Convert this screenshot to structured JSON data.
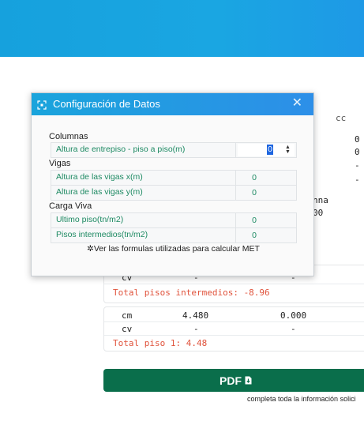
{
  "background": {
    "header_fragment": "cc",
    "right_values": [
      "0",
      "0",
      "-",
      "-"
    ],
    "fragment_nna": "nna",
    "fragment_oo": "00",
    "card_intermedios": {
      "row_cv": {
        "label": "cv",
        "v1": "-",
        "v2": "-"
      },
      "total": "Total pisos intermedios: -8.96"
    },
    "card_piso1": {
      "row_cm": {
        "label": "cm",
        "v1": "4.480",
        "v2": "0.000"
      },
      "row_cv": {
        "label": "cv",
        "v1": "-",
        "v2": "-"
      },
      "total": "Total piso 1: 4.48"
    },
    "pdf_button": {
      "label": "PDF",
      "icon": "file-download-icon"
    },
    "pdf_note": "completa toda la información solici"
  },
  "dialog": {
    "title": "Configuración de Datos",
    "sections": [
      {
        "label": "Columnas",
        "fields": [
          {
            "label": "Altura de entrepiso - piso a piso(m)",
            "value": "0",
            "active": true
          }
        ]
      },
      {
        "label": "Vigas",
        "fields": [
          {
            "label": "Altura de las vigas x(m)",
            "value": "0"
          },
          {
            "label": "Altura de las vigas y(m)",
            "value": "0"
          }
        ]
      },
      {
        "label": "Carga Viva",
        "fields": [
          {
            "label": "Ultimo piso(tn/m2)",
            "value": "0"
          },
          {
            "label": "Pisos intermedios(tn/m2)",
            "value": "0"
          }
        ]
      }
    ],
    "formula_link": "Ver las formulas utilizadas para calcular MET"
  },
  "colors": {
    "header": "#1aa6e2",
    "pdf_button": "#0a6e4b",
    "field_text": "#1e8a63",
    "total_text": "#e0533c"
  }
}
